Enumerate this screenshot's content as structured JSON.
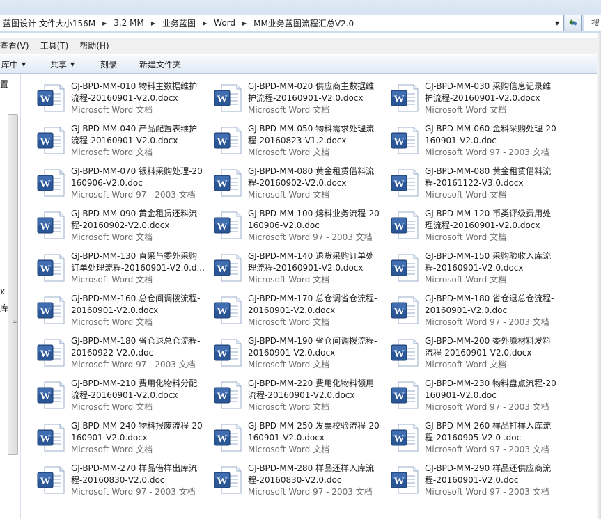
{
  "address": {
    "crumbs": [
      "蓝图设计 文件大小156M",
      "3.2 MM",
      "业务蓝图",
      "Word",
      "MM业务蓝图流程汇总V2.0"
    ],
    "search_fragment": "搜"
  },
  "menu": {
    "items": [
      "查看(V)",
      "工具(T)",
      "帮助(H)"
    ]
  },
  "toolbar": {
    "include_label": "库中",
    "share_label": "共享",
    "burn_label": "刻录",
    "new_folder_label": "新建文件夹"
  },
  "nav": {
    "labels": [
      "置",
      "x",
      "库",
      "="
    ]
  },
  "files": [
    {
      "name": "GJ-BPD-MM-010 物料主数据维护流程-20160901-V2.0.docx",
      "type": "Microsoft Word 文档"
    },
    {
      "name": "GJ-BPD-MM-020 供应商主数据维护流程-20160901-V2.0.docx",
      "type": "Microsoft Word 文档"
    },
    {
      "name": "GJ-BPD-MM-030 采购信息记录维护流程-20160901-V2.0.docx",
      "type": "Microsoft Word 文档"
    },
    {
      "name": "GJ-BPD-MM-040 产品配置表维护流程-20160901-V2.0.docx",
      "type": "Microsoft Word 文档"
    },
    {
      "name": "GJ-BPD-MM-050 物料需求处理流程-20160823-V1.2.docx",
      "type": "Microsoft Word 文档"
    },
    {
      "name": "GJ-BPD-MM-060 金料采购处理-20160901-V2.0.doc",
      "type": "Microsoft Word 97 - 2003 文档"
    },
    {
      "name": "GJ-BPD-MM-070 银料采购处理-20160906-V2.0.doc",
      "type": "Microsoft Word 97 - 2003 文档"
    },
    {
      "name": "GJ-BPD-MM-080 黄金租赁借料流程-20160902-V2.0.docx",
      "type": "Microsoft Word 文档"
    },
    {
      "name": "GJ-BPD-MM-080 黄金租赁借料流程-20161122-V3.0.docx",
      "type": "Microsoft Word 文档"
    },
    {
      "name": "GJ-BPD-MM-090 黄金租赁还料流程-20160902-V2.0.docx",
      "type": "Microsoft Word 文档"
    },
    {
      "name": "GJ-BPD-MM-100 熔料业务流程-20160906-V2.0.doc",
      "type": "Microsoft Word 97 - 2003 文档"
    },
    {
      "name": "GJ-BPD-MM-120 币类评级费用处理流程-20160901-V2.0.docx",
      "type": "Microsoft Word 文档"
    },
    {
      "name": "GJ-BPD-MM-130 直采与委外采购订单处理流程-20160901-V2.0.d...",
      "type": "Microsoft Word 文档"
    },
    {
      "name": "GJ-BPD-MM-140 退货采购订单处理流程-20160901-V2.0.docx",
      "type": "Microsoft Word 文档"
    },
    {
      "name": "GJ-BPD-MM-150 采购验收入库流程-20160901-V2.0.docx",
      "type": "Microsoft Word 文档"
    },
    {
      "name": "GJ-BPD-MM-160 总仓间调拨流程-20160901-V2.0.docx",
      "type": "Microsoft Word 文档"
    },
    {
      "name": "GJ-BPD-MM-170 总仓调省仓流程-20160901-V2.0.docx",
      "type": "Microsoft Word 文档"
    },
    {
      "name": "GJ-BPD-MM-180 省仓退总仓流程-20160901-V2.0.doc",
      "type": "Microsoft Word 97 - 2003 文档"
    },
    {
      "name": "GJ-BPD-MM-180 省仓退总仓流程-20160922-V2.0.doc",
      "type": "Microsoft Word 97 - 2003 文档"
    },
    {
      "name": "GJ-BPD-MM-190 省仓间调拨流程-20160901-V2.0.docx",
      "type": "Microsoft Word 文档"
    },
    {
      "name": "GJ-BPD-MM-200 委外原材料发料流程-20160901-V2.0.docx",
      "type": "Microsoft Word 文档"
    },
    {
      "name": "GJ-BPD-MM-210 费用化物料分配流程-20160901-V2.0.docx",
      "type": "Microsoft Word 文档"
    },
    {
      "name": "GJ-BPD-MM-220 费用化物料领用流程-20160901-V2.0.docx",
      "type": "Microsoft Word 文档"
    },
    {
      "name": "GJ-BPD-MM-230 物料盘点流程-20160901-V2.0.doc",
      "type": "Microsoft Word 97 - 2003 文档"
    },
    {
      "name": "GJ-BPD-MM-240 物料报废流程-20160901-V2.0.docx",
      "type": "Microsoft Word 文档"
    },
    {
      "name": "GJ-BPD-MM-250 发票校验流程-20160901-V2.0.docx",
      "type": "Microsoft Word 文档"
    },
    {
      "name": "GJ-BPD-MM-260 样品打样入库流程-20160905-V2.0 .doc",
      "type": "Microsoft Word 97 - 2003 文档"
    },
    {
      "name": "GJ-BPD-MM-270 样品借样出库流程-20160830-V2.0.doc",
      "type": "Microsoft Word 97 - 2003 文档"
    },
    {
      "name": "GJ-BPD-MM-280 样品还样入库流程-20160830-V2.0.doc",
      "type": "Microsoft Word 97 - 2003 文档"
    },
    {
      "name": "GJ-BPD-MM-290 样品还供应商流程-20160901-V2.0.doc",
      "type": "Microsoft Word 97 - 2003 文档"
    }
  ],
  "colors": {
    "word_blue": "#2b5797",
    "chrome_blue": "#cfdcec"
  }
}
